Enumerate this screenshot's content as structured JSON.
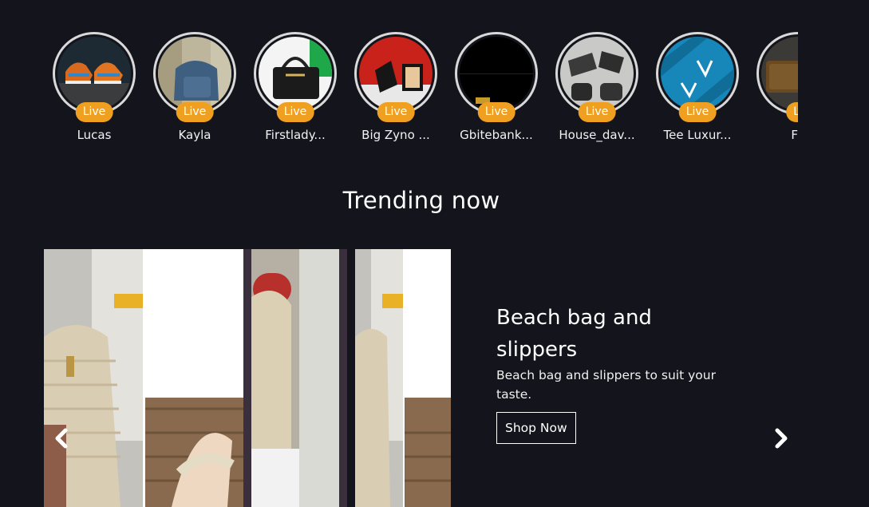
{
  "stories": [
    {
      "name": "Lucas",
      "badge": "Live"
    },
    {
      "name": "Kayla",
      "badge": "Live"
    },
    {
      "name": "Firstlady...",
      "badge": "Live"
    },
    {
      "name": "Big Zyno ...",
      "badge": "Live"
    },
    {
      "name": "Gbitebank...",
      "badge": "Live"
    },
    {
      "name": "House_dav...",
      "badge": "Live"
    },
    {
      "name": "Tee Luxur...",
      "badge": "Live"
    },
    {
      "name": "Fo",
      "badge": "Li"
    }
  ],
  "section_title": "Trending now",
  "slide": {
    "title": "Beach bag and slippers",
    "description": "Beach bag and slippers to suit your taste.",
    "cta": "Shop Now"
  },
  "colors": {
    "background": "#13141c",
    "live_badge": "#f0a020"
  },
  "icons": {
    "prev": "chevron-left-icon",
    "next": "chevron-right-icon"
  }
}
